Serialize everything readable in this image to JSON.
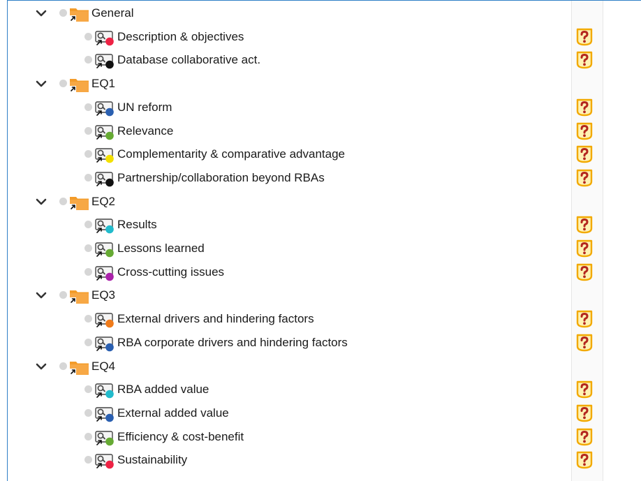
{
  "tree": [
    {
      "type": "folder",
      "label": "General"
    },
    {
      "type": "code",
      "label": "Description & objectives",
      "color": "#ee2244"
    },
    {
      "type": "code",
      "label": "Database collaborative act.",
      "color": "#111111"
    },
    {
      "type": "folder",
      "label": "EQ1"
    },
    {
      "type": "code",
      "label": "UN reform",
      "color": "#2a5fb0"
    },
    {
      "type": "code",
      "label": "Relevance",
      "color": "#66aa33"
    },
    {
      "type": "code",
      "label": "Complementarity & comparative advantage",
      "color": "#f3e000"
    },
    {
      "type": "code",
      "label": "Partnership/collaboration beyond RBAs",
      "color": "#111111"
    },
    {
      "type": "folder",
      "label": "EQ2"
    },
    {
      "type": "code",
      "label": "Results",
      "color": "#22bbcc"
    },
    {
      "type": "code",
      "label": "Lessons learned",
      "color": "#66aa33"
    },
    {
      "type": "code",
      "label": "Cross-cutting issues",
      "color": "#aa22aa"
    },
    {
      "type": "folder",
      "label": "EQ3"
    },
    {
      "type": "code",
      "label": "External drivers and hindering factors",
      "color": "#f07b1a"
    },
    {
      "type": "code",
      "label": "RBA corporate drivers and hindering factors",
      "color": "#2a5fb0"
    },
    {
      "type": "folder",
      "label": "EQ4"
    },
    {
      "type": "code",
      "label": "RBA added value",
      "color": "#22bbcc"
    },
    {
      "type": "code",
      "label": "External added value",
      "color": "#2a5fb0"
    },
    {
      "type": "code",
      "label": "Efficiency & cost-benefit",
      "color": "#66aa33"
    },
    {
      "type": "code",
      "label": "Sustainability",
      "color": "#ee2244"
    }
  ],
  "icons": {
    "expand": "chevron-down-icon",
    "folder": "folder-icon",
    "code": "code-icon",
    "status_dot": "status-dot-icon",
    "help": "question-mark-icon"
  },
  "colors": {
    "folder": "#f39c2a",
    "help_fill": "#fff2b3",
    "help_border": "#f2a900",
    "help_mark": "#b3261e"
  }
}
